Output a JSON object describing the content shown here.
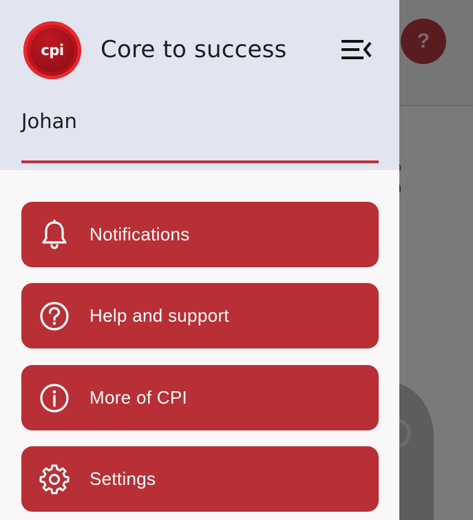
{
  "app": {
    "title": "Core to success",
    "logo_text": "cpi"
  },
  "user": {
    "name": "Johan"
  },
  "background": {
    "help_glyph": "?",
    "text_fragments": [
      "o",
      "n",
      "l"
    ]
  },
  "menu": {
    "items": [
      {
        "label": "Notifications",
        "icon": "bell-icon"
      },
      {
        "label": "Help and support",
        "icon": "help-circle-icon"
      },
      {
        "label": "More of CPI",
        "icon": "info-circle-icon"
      },
      {
        "label": "Settings",
        "icon": "gear-icon"
      }
    ]
  },
  "colors": {
    "accent": "#b82f35",
    "header_bg": "#e2e5ef",
    "drawer_bg": "#faf7f9",
    "scrim": "#7a7a7a"
  }
}
